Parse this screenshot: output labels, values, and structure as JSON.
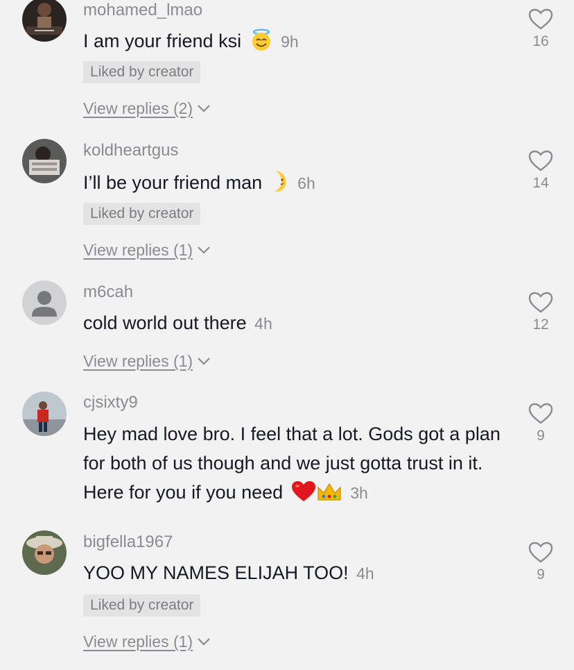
{
  "comments": [
    {
      "username": "mohamed_lmao",
      "text": "I am your friend ksi",
      "emoji": "innocent-smile",
      "time": "9h",
      "badge": "Liked by creator",
      "replies": "View replies (2)",
      "likes": "16",
      "avatar": "photo-dark"
    },
    {
      "username": "koldheartgus",
      "text": "I’ll be your friend man",
      "emoji": "crescent-moon",
      "time": "6h",
      "badge": "Liked by creator",
      "replies": "View replies (1)",
      "likes": "14",
      "avatar": "photo-grey"
    },
    {
      "username": "m6cah",
      "text": "cold world out there",
      "time": "4h",
      "replies": "View replies (1)",
      "likes": "12",
      "avatar": "default-silhouette"
    },
    {
      "username": "cjsixty9",
      "text": "Hey mad love bro. I feel that a lot. Gods got a plan for both of us though and we just gotta trust in it. Here for you if you need",
      "emoji": "red-heart crown",
      "time": "3h",
      "replies": "View replies (1)",
      "likes": "9",
      "avatar": "photo-red-shirt"
    },
    {
      "username": "bigfella1967",
      "text": "YOO MY NAMES ELIJAH TOO!",
      "time": "4h",
      "badge": "Liked by creator",
      "replies": "View replies (1)",
      "likes": "9",
      "avatar": "photo-hat"
    }
  ],
  "colors": {
    "background": "#f2f2f2",
    "text": "#161823",
    "muted": "#8a8b91",
    "badge_bg": "#e3e3e4"
  }
}
